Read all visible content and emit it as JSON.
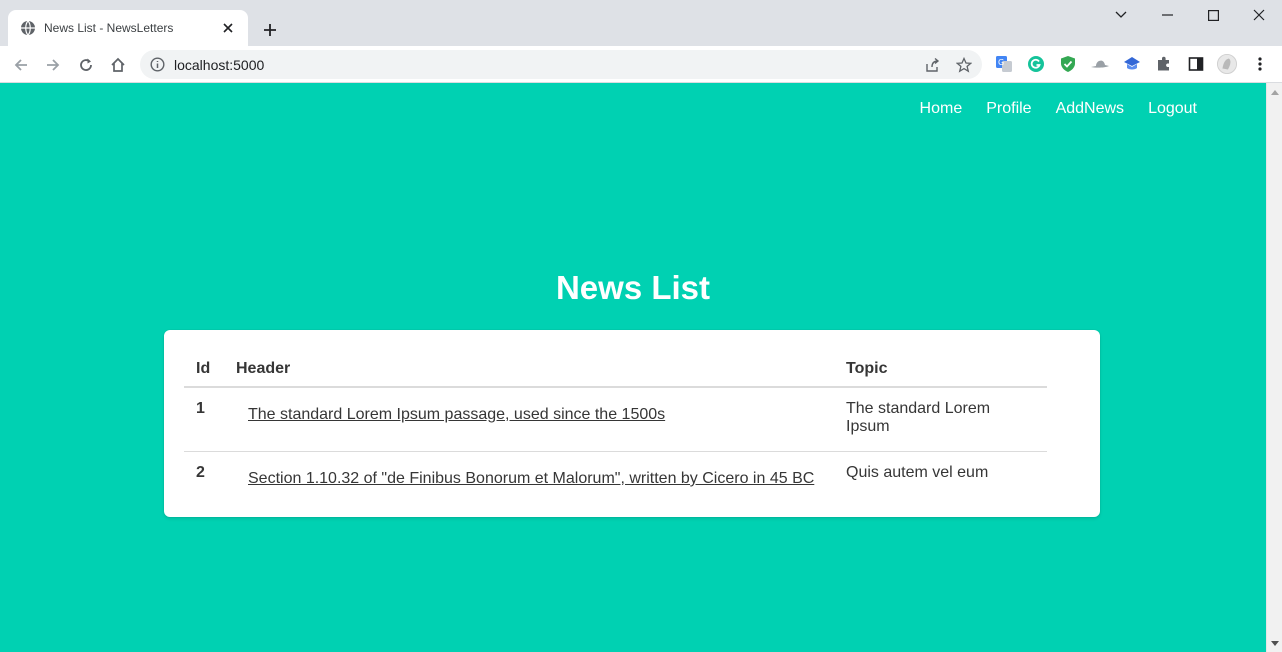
{
  "browser": {
    "tab_title": "News List - NewsLetters",
    "url": "localhost:5000"
  },
  "nav": {
    "items": [
      "Home",
      "Profile",
      "AddNews",
      "Logout"
    ]
  },
  "page": {
    "title": "News List"
  },
  "table": {
    "columns": [
      "Id",
      "Header",
      "Topic"
    ],
    "rows": [
      {
        "id": "1",
        "header": "The standard Lorem Ipsum passage, used since the 1500s",
        "topic": "The standard Lorem Ipsum"
      },
      {
        "id": "2",
        "header": "Section 1.10.32 of \"de Finibus Bonorum et Malorum\", written by Cicero in 45 BC",
        "topic": "Quis autem vel eum"
      }
    ]
  },
  "colors": {
    "page_background": "#00d1b2",
    "card_background": "#ffffff",
    "text": "#363636"
  },
  "icons": [
    "globe-icon",
    "close-icon",
    "plus-icon",
    "back-icon",
    "forward-icon",
    "reload-icon",
    "home-icon",
    "info-icon",
    "share-icon",
    "star-icon",
    "translate-extension-icon",
    "grammarly-extension-icon",
    "shield-extension-icon",
    "hat-extension-icon",
    "cap-extension-icon",
    "puzzle-icon",
    "sidepanel-icon",
    "avatar",
    "kebab-menu-icon"
  ]
}
